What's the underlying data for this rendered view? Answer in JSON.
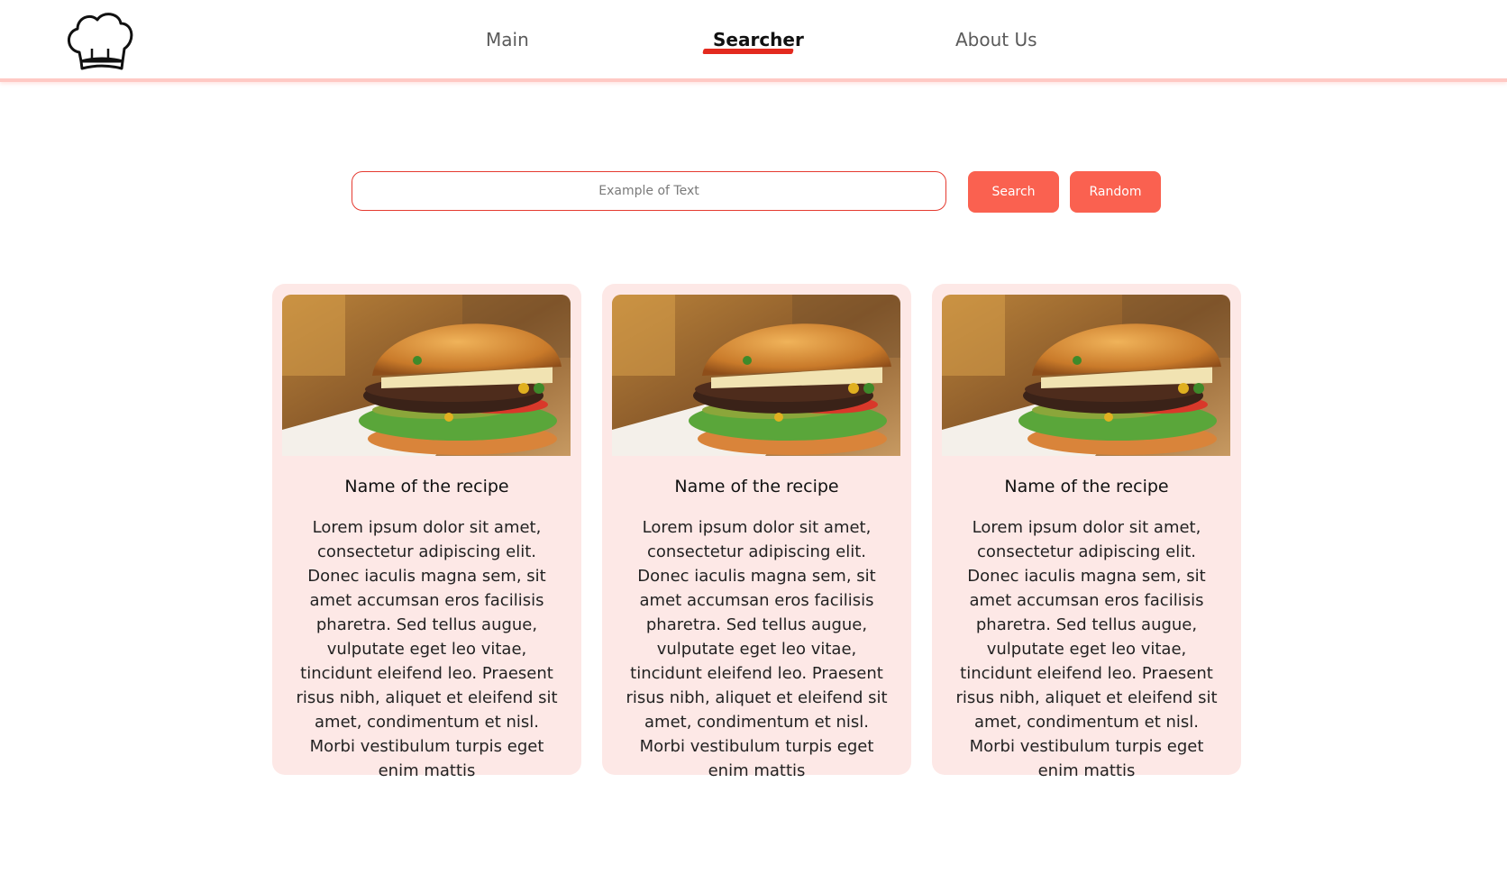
{
  "header": {
    "logo_icon": "chef-hat-icon",
    "nav": [
      {
        "label": "Main",
        "active": false
      },
      {
        "label": "Searcher",
        "active": true
      },
      {
        "label": "About Us",
        "active": false
      }
    ]
  },
  "search": {
    "placeholder": "Example of Text",
    "search_label": "Search",
    "random_label": "Random"
  },
  "cards": [
    {
      "image_icon": "burger-photo",
      "title": "Name of the recipe",
      "description": "Lorem ipsum dolor sit amet, consectetur adipiscing elit. Donec iaculis magna sem, sit amet accumsan eros facilisis pharetra. Sed tellus augue, vulputate eget leo vitae, tincidunt eleifend leo. Praesent risus nibh, aliquet et eleifend sit amet, condimentum et nisl. Morbi vestibulum turpis eget enim mattis"
    },
    {
      "image_icon": "burger-photo",
      "title": "Name of the recipe",
      "description": "Lorem ipsum dolor sit amet, consectetur adipiscing elit. Donec iaculis magna sem, sit amet accumsan eros facilisis pharetra. Sed tellus augue, vulputate eget leo vitae, tincidunt eleifend leo. Praesent risus nibh, aliquet et eleifend sit amet, condimentum et nisl. Morbi vestibulum turpis eget enim mattis"
    },
    {
      "image_icon": "burger-photo",
      "title": "Name of the recipe",
      "description": "Lorem ipsum dolor sit amet, consectetur adipiscing elit. Donec iaculis magna sem, sit amet accumsan eros facilisis pharetra. Sed tellus augue, vulputate eget leo vitae, tincidunt eleifend leo. Praesent risus nibh, aliquet et eleifend sit amet, condimentum et nisl. Morbi vestibulum turpis eget enim mattis"
    }
  ],
  "colors": {
    "accent": "#fa6150",
    "accent_dark": "#e32a1f",
    "card_bg": "#fde8e6",
    "header_border": "#ffc9c4"
  }
}
